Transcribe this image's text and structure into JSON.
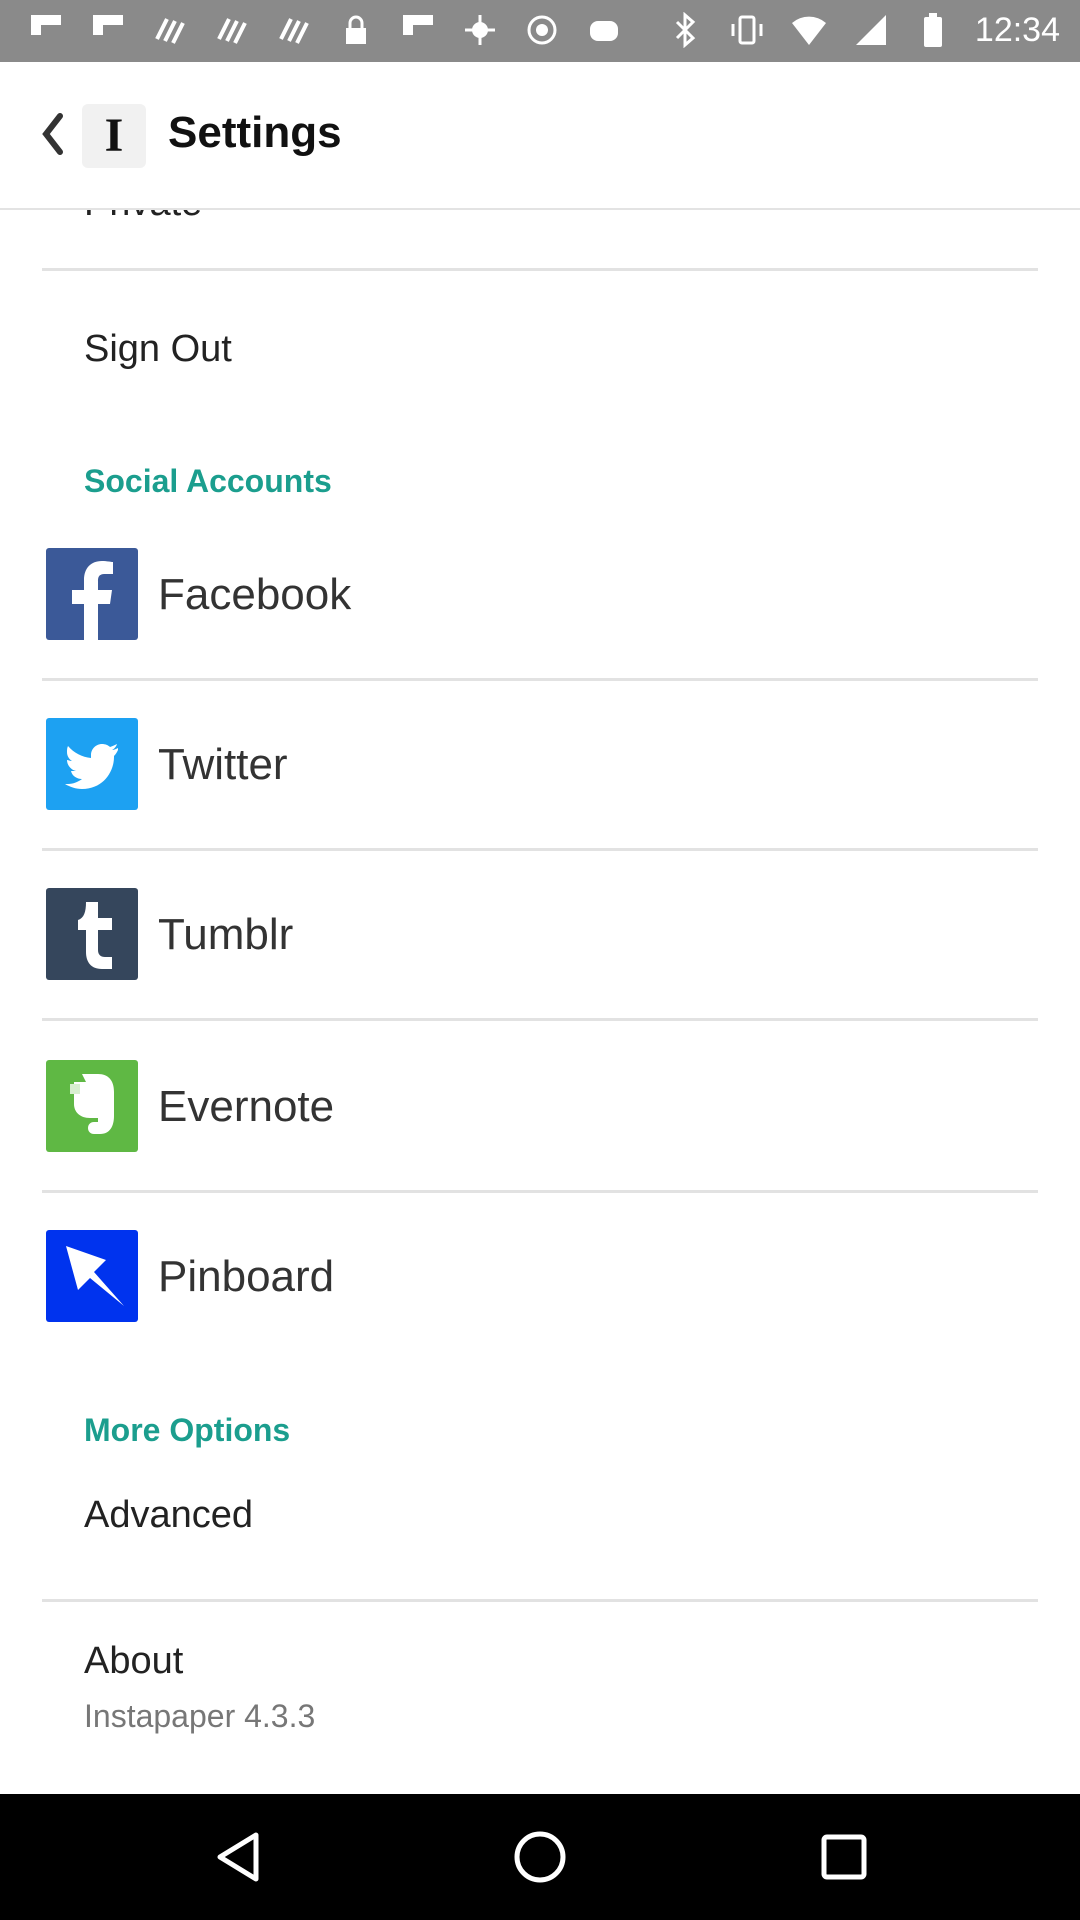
{
  "status_bar": {
    "time": "12:34",
    "left_icons": [
      "flipboard-icon",
      "flipboard-icon",
      "vpn-wave-icon",
      "vpn-wave-icon",
      "vpn-wave-icon",
      "lock-icon",
      "flipboard-icon",
      "fake-gps-icon",
      "circle-status-icon",
      "game-icon"
    ],
    "right_icons": [
      "bluetooth-icon",
      "vibrate-icon",
      "wifi-icon",
      "signal-icon",
      "battery-icon"
    ]
  },
  "app_bar": {
    "logo_text": "I",
    "title": "Settings"
  },
  "content": {
    "partial_item": "Private",
    "sign_out": "Sign Out",
    "social_header": "Social Accounts",
    "social_accounts": [
      {
        "label": "Facebook",
        "icon": "facebook-icon",
        "color": "#3b5998"
      },
      {
        "label": "Twitter",
        "icon": "twitter-icon",
        "color": "#1da1f2"
      },
      {
        "label": "Tumblr",
        "icon": "tumblr-icon",
        "color": "#35465c"
      },
      {
        "label": "Evernote",
        "icon": "evernote-icon",
        "color": "#5fb844"
      },
      {
        "label": "Pinboard",
        "icon": "pinboard-icon",
        "color": "#0033ee"
      }
    ],
    "more_header": "More Options",
    "advanced": "Advanced",
    "about": "About",
    "about_version": "Instapaper 4.3.3"
  },
  "colors": {
    "section_header": "#1b9e8e",
    "status_bar": "#8a8a8a"
  },
  "nav_bar": {
    "buttons": [
      "back-triangle-icon",
      "home-circle-icon",
      "recents-square-icon"
    ]
  }
}
